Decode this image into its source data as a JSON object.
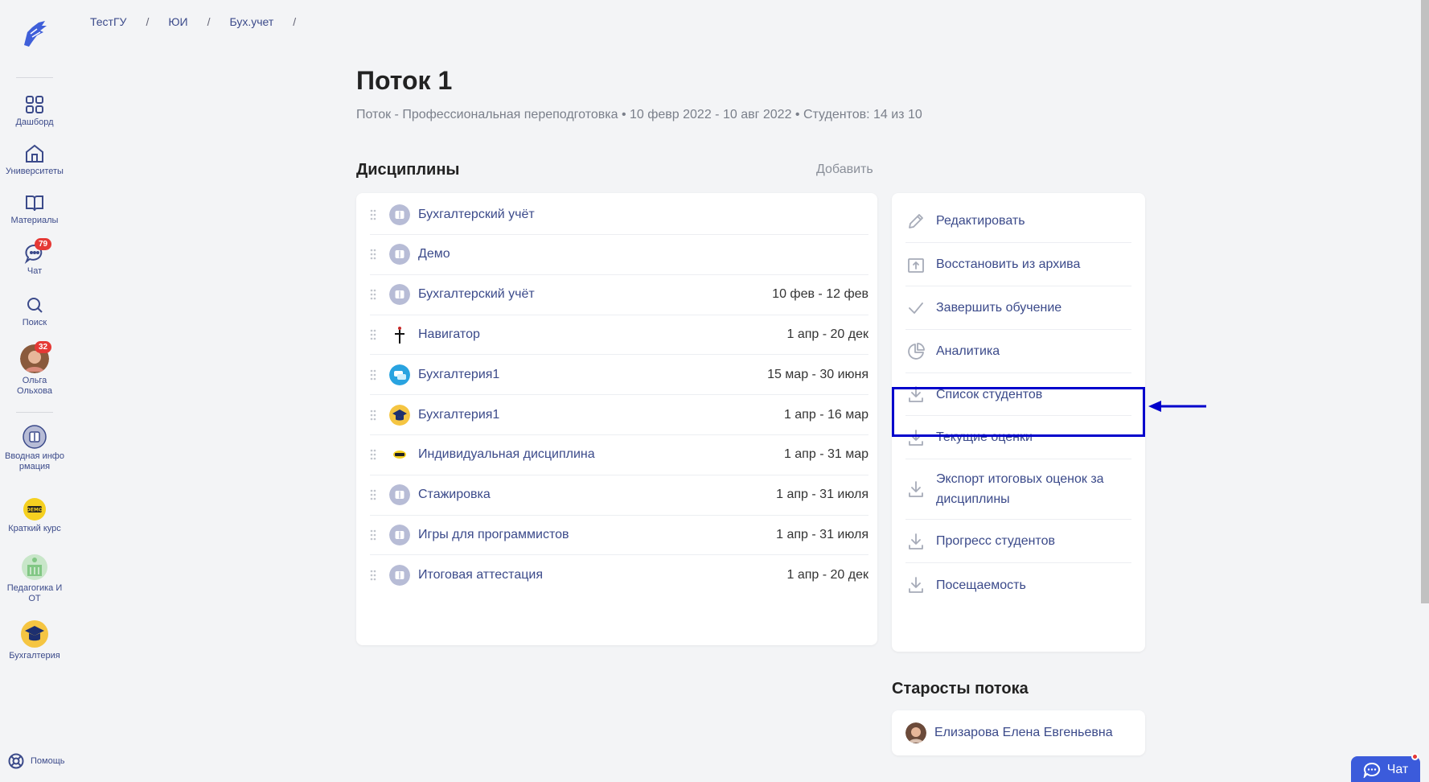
{
  "breadcrumb": [
    "ТестГУ",
    "ЮИ",
    "Бух.учет"
  ],
  "page": {
    "title": "Поток 1",
    "subtitle": "Поток - Профессиональная переподготовка • 10 февр 2022 - 10 авг 2022 • Студентов: 14 из 10"
  },
  "sidebar": {
    "nav": [
      {
        "label": "Дашборд",
        "icon": "dashboard-grid-icon"
      },
      {
        "label": "Университеты",
        "icon": "university-icon"
      },
      {
        "label": "Материалы",
        "icon": "book-icon"
      },
      {
        "label": "Чат",
        "icon": "chat-icon",
        "badge": "79"
      },
      {
        "label": "Поиск",
        "icon": "search-icon"
      }
    ],
    "user": {
      "name": "Ольга Ольхова",
      "badge": "32"
    },
    "courses": [
      {
        "label": "Вводная инфо рмация",
        "icon": "course-book-icon"
      },
      {
        "label": "Краткий курс",
        "icon": "demo-icon"
      },
      {
        "label": "Педагогика И ОТ",
        "icon": "building-icon"
      },
      {
        "label": "Бухгалтерия",
        "icon": "graduation-icon"
      }
    ],
    "help": "Помощь"
  },
  "disciplines": {
    "title": "Дисциплины",
    "add_label": "Добавить",
    "items": [
      {
        "name": "Бухгалтерский учёт",
        "dates": "",
        "icon": "book"
      },
      {
        "name": "Демо",
        "dates": "",
        "icon": "book"
      },
      {
        "name": "Бухгалтерский учёт",
        "dates": "10 фев - 12 фев",
        "icon": "book"
      },
      {
        "name": "Навигатор",
        "dates": "1 апр - 20 дек",
        "icon": "figure"
      },
      {
        "name": "Бухгалтерия1",
        "dates": "15 мар - 30 июня",
        "icon": "chat"
      },
      {
        "name": "Бухгалтерия1",
        "dates": "1 апр - 16 мар",
        "icon": "grad"
      },
      {
        "name": "Индивидуальная дисциплина",
        "dates": "1 апр - 31 мар",
        "icon": "demo"
      },
      {
        "name": "Стажировка",
        "dates": "1 апр - 31 июля",
        "icon": "book"
      },
      {
        "name": "Игры для программистов",
        "dates": "1 апр - 31 июля",
        "icon": "book"
      },
      {
        "name": "Итоговая аттестация",
        "dates": "1 апр - 20 дек",
        "icon": "book"
      }
    ]
  },
  "actions": [
    {
      "label": "Редактировать",
      "icon": "pencil-icon"
    },
    {
      "label": "Восстановить из архива",
      "icon": "archive-restore-icon"
    },
    {
      "label": "Завершить обучение",
      "icon": "check-icon"
    },
    {
      "label": "Аналитика",
      "icon": "pie-chart-icon"
    },
    {
      "label": "Список студентов",
      "icon": "download-icon",
      "highlighted": true
    },
    {
      "label": "Текущие оценки",
      "icon": "download-icon"
    },
    {
      "label": "Экспорт итоговых оценок за дисциплины",
      "icon": "download-icon"
    },
    {
      "label": "Прогресс студентов",
      "icon": "download-icon"
    },
    {
      "label": "Посещаемость",
      "icon": "download-icon"
    }
  ],
  "starosty": {
    "title": "Старосты потока",
    "items": [
      {
        "name": "Елизарова Елена Евгеньевна"
      }
    ]
  },
  "chat_widget": {
    "label": "Чат"
  },
  "colors": {
    "link": "#3b4a8a",
    "highlight": "#0000cc",
    "badge": "#e53935",
    "chat_widget": "#3b5bdb"
  }
}
